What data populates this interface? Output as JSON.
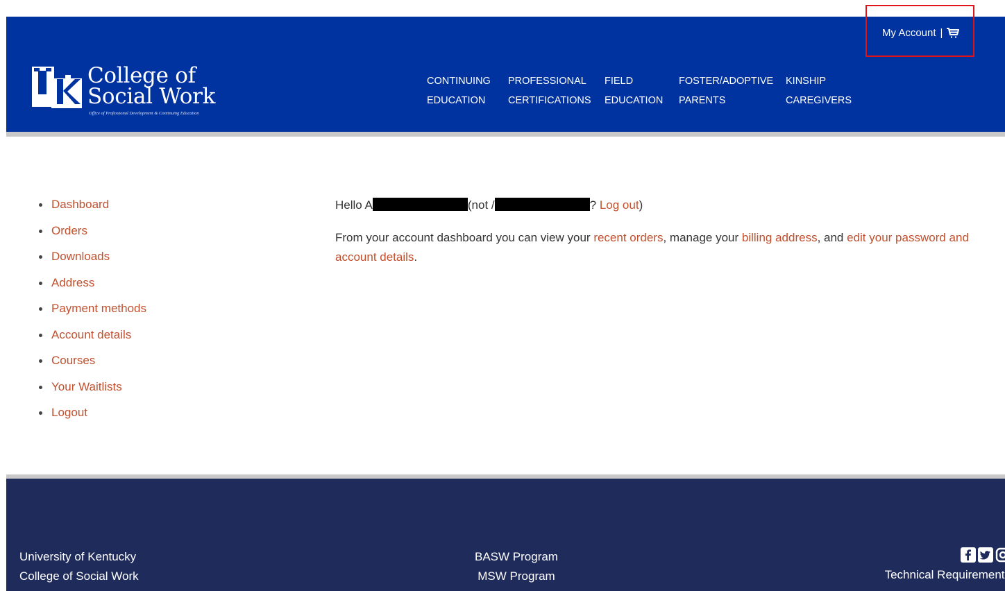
{
  "header": {
    "account_label": "My Account",
    "account_separator": "|",
    "cart_icon": "cart-icon",
    "logo": {
      "line1": "College of",
      "line2": "Social Work",
      "subtitle": "Office of Professional Development & Continuing Education"
    },
    "nav": [
      {
        "line1": "CONTINUING",
        "line2": "EDUCATION"
      },
      {
        "line1": "PROFESSIONAL",
        "line2": "CERTIFICATIONS"
      },
      {
        "line1": "FIELD",
        "line2": "EDUCATION"
      },
      {
        "line1": "FOSTER/ADOPTIVE",
        "line2": "PARENTS"
      },
      {
        "line1": "KINSHIP",
        "line2": "CAREGIVERS"
      }
    ]
  },
  "account_menu": [
    {
      "label": "Dashboard"
    },
    {
      "label": "Orders"
    },
    {
      "label": "Downloads"
    },
    {
      "label": "Address"
    },
    {
      "label": "Payment methods"
    },
    {
      "label": "Account details"
    },
    {
      "label": "Courses"
    },
    {
      "label": "Your Waitlists"
    },
    {
      "label": "Logout"
    }
  ],
  "dashboard": {
    "hello_prefix": "Hello A",
    "not_prefix": "(not /",
    "question_mark": "?",
    "logout_link": "Log out",
    "close_paren": ")",
    "intro_part1": "From your account dashboard you can view your ",
    "recent_orders_link": "recent orders",
    "intro_part2": ", manage your ",
    "billing_link": "billing address",
    "intro_part3": ", and ",
    "edit_link": "edit your password and account details",
    "intro_end": "."
  },
  "footer": {
    "col1": [
      "University of Kentucky",
      "College of Social Work"
    ],
    "col2": [
      "BASW Program",
      "MSW Program"
    ],
    "social_icons": [
      "facebook-icon",
      "twitter-icon",
      "instagram-icon"
    ],
    "technical_requirements": "Technical Requirements"
  },
  "colors": {
    "header_blue": "#0033a0",
    "footer_navy": "#1f2b5a",
    "link": "#c0502e",
    "highlight": "#e0121a"
  }
}
